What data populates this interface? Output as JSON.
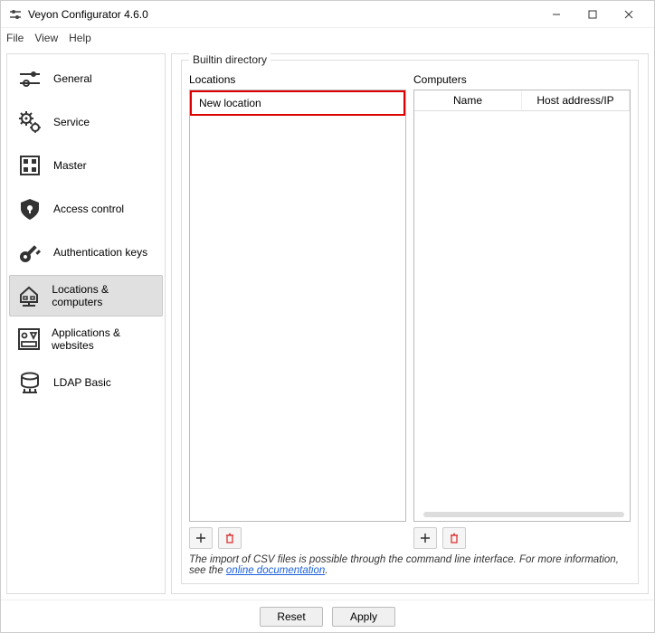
{
  "window": {
    "title": "Veyon Configurator 4.6.0"
  },
  "menu": {
    "file": "File",
    "view": "View",
    "help": "Help"
  },
  "sidebar": {
    "items": [
      {
        "label": "General"
      },
      {
        "label": "Service"
      },
      {
        "label": "Master"
      },
      {
        "label": "Access control"
      },
      {
        "label": "Authentication keys"
      },
      {
        "label": "Locations & computers"
      },
      {
        "label": "Applications & websites"
      },
      {
        "label": "LDAP Basic"
      }
    ],
    "selected_index": 5
  },
  "group": {
    "title": "Builtin directory",
    "locations_label": "Locations",
    "computers_label": "Computers",
    "locations": [
      {
        "name": "New location"
      }
    ],
    "computers_columns": {
      "name": "Name",
      "host": "Host address/IP"
    },
    "computers_rows": []
  },
  "hint": {
    "prefix": "The import of CSV files is possible through the command line interface. For more information, see the ",
    "link": "online documentation",
    "suffix": "."
  },
  "footer": {
    "reset": "Reset",
    "apply": "Apply"
  },
  "icons": {
    "add": "add-icon",
    "delete": "trash-icon"
  }
}
